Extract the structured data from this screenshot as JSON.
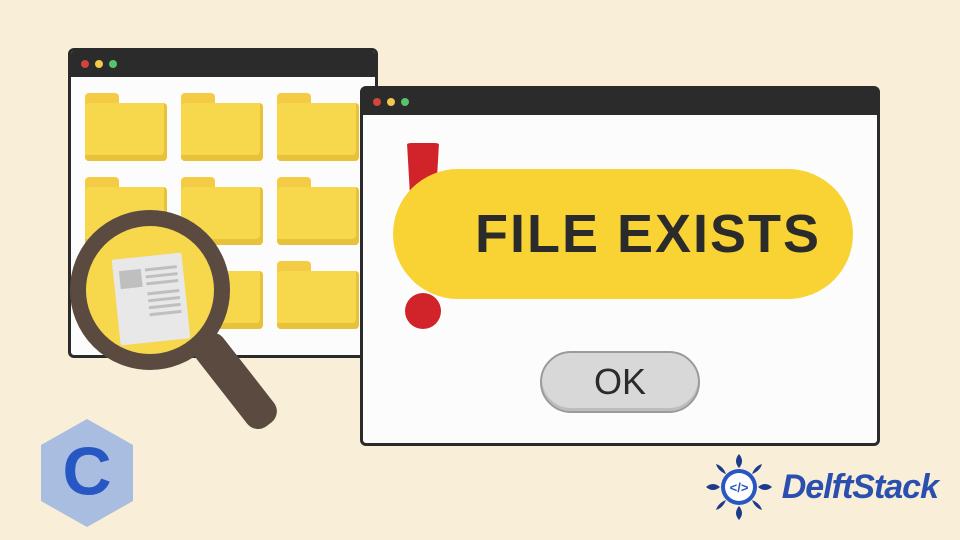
{
  "dialog": {
    "message": "FILE EXISTS",
    "ok_label": "OK"
  },
  "brand": {
    "c_letter": "C",
    "delftstack": "DelftStack",
    "ds_code": "</>"
  },
  "colors": {
    "bg": "#f9eed7",
    "titlebar": "#2b2b2b",
    "pill": "#f9d334",
    "alert_red": "#d1232a",
    "ok_fill": "#d8d8d8",
    "c_blue": "#2757c2",
    "ds_blue": "#2a4fb0",
    "ds_navy": "#1e2a5a"
  },
  "icons": {
    "traffic_red": "close-icon",
    "traffic_yellow": "minimize-icon",
    "traffic_green": "zoom-icon",
    "folder": "folder-icon",
    "magnifier": "search-icon",
    "exclaim": "exclamation-icon"
  }
}
